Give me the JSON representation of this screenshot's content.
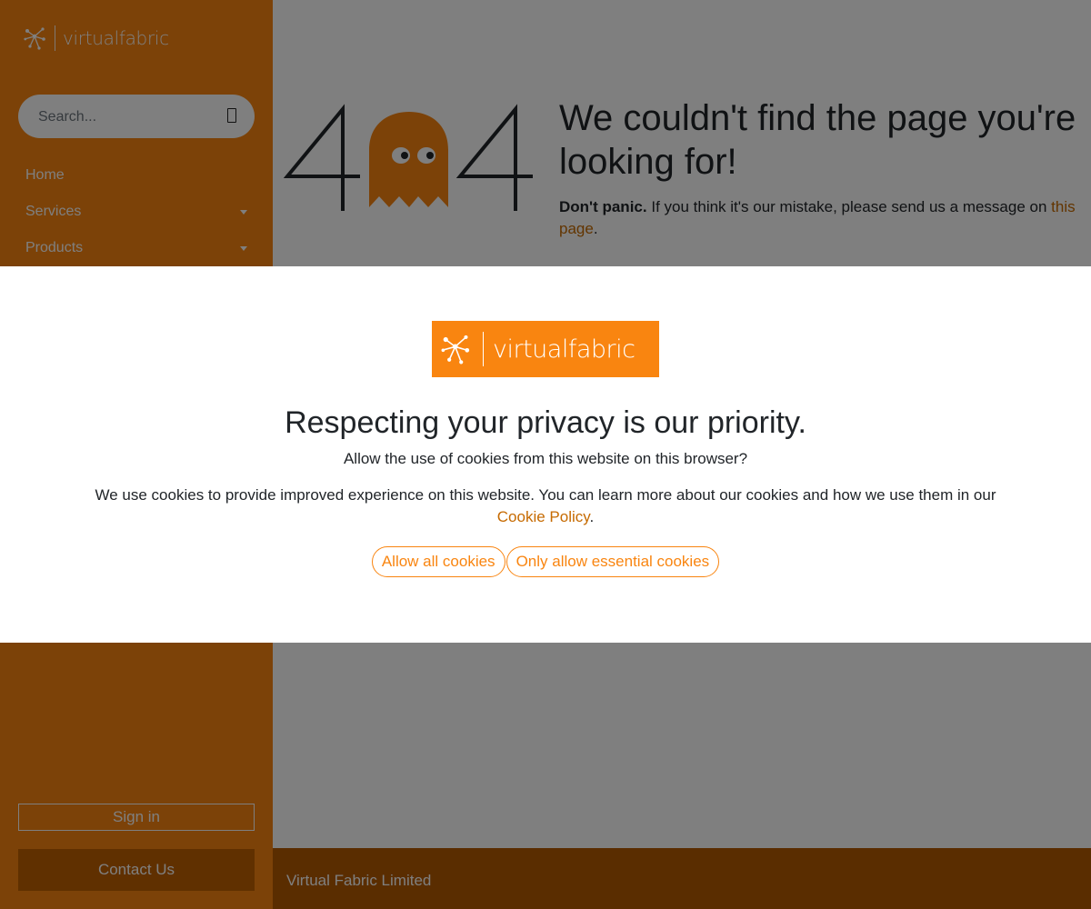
{
  "brand": {
    "name": "virtualfabric"
  },
  "search": {
    "placeholder": "Search..."
  },
  "nav": [
    {
      "label": "Home"
    },
    {
      "label": "Services"
    },
    {
      "label": "Products"
    }
  ],
  "sidebar": {
    "signin_label": "Sign in",
    "contact_label": "Contact Us"
  },
  "error": {
    "code": "404",
    "headline": "We couldn't find the page you're looking for!",
    "strong": "Don't panic.",
    "text": "If you think it's our mistake, please send us a message on",
    "link": "this page",
    "end": "."
  },
  "footer": {
    "text": "Virtual Fabric Limited"
  },
  "cookie_modal": {
    "title": "Respecting your privacy is our priority.",
    "question": "Allow the use of cookies from this website on this browser?",
    "body": "We use cookies to provide improved experience on this website. You can learn more about our cookies and how we use them in our",
    "link": "Cookie Policy",
    "end": ".",
    "allow_all": "Allow all cookies",
    "essential_only": "Only allow essential cookies"
  },
  "colors": {
    "brand_orange": "#f98510",
    "link": "#c66a00",
    "footer": "#b55a00",
    "overlay": "rgba(0,0,0,0.5)"
  },
  "icons": [
    "network-logo-icon",
    "search-icon",
    "caret-down-icon",
    "ghost-icon"
  ]
}
